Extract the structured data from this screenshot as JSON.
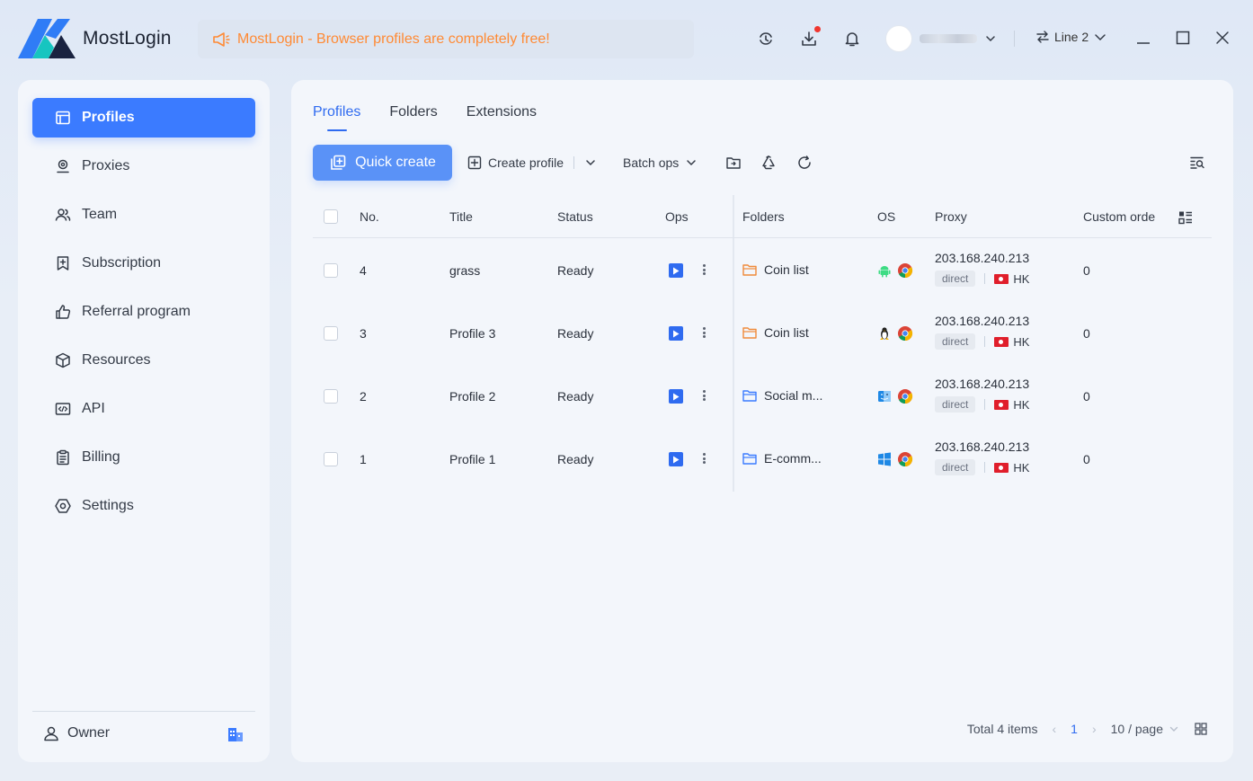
{
  "app": {
    "brand": "MostLogin",
    "announcement": "MostLogin - Browser profiles are completely free!",
    "line_label": "Line 2",
    "accent_color": "#3b7bff",
    "announce_color": "#ff8a34"
  },
  "sidebar": {
    "items": [
      {
        "label": "Profiles",
        "icon": "profile-window-icon",
        "active": true
      },
      {
        "label": "Proxies",
        "icon": "location-pin-icon"
      },
      {
        "label": "Team",
        "icon": "team-icon"
      },
      {
        "label": "Subscription",
        "icon": "bookmark-plus-icon"
      },
      {
        "label": "Referral program",
        "icon": "thumbs-up-icon"
      },
      {
        "label": "Resources",
        "icon": "cube-icon"
      },
      {
        "label": "API",
        "icon": "code-window-icon"
      },
      {
        "label": "Billing",
        "icon": "clipboard-icon"
      },
      {
        "label": "Settings",
        "icon": "gear-hexagon-icon"
      }
    ],
    "owner_label": "Owner"
  },
  "main": {
    "tabs": [
      {
        "label": "Profiles",
        "active": true
      },
      {
        "label": "Folders"
      },
      {
        "label": "Extensions"
      }
    ],
    "toolbar": {
      "quick_create": "Quick create",
      "create_profile": "Create profile",
      "batch_ops": "Batch ops"
    },
    "columns": {
      "no": "No.",
      "title": "Title",
      "status": "Status",
      "ops": "Ops",
      "folders": "Folders",
      "os": "OS",
      "proxy": "Proxy",
      "custom_order": "Custom orde"
    },
    "rows": [
      {
        "no": "4",
        "title": "grass",
        "status": "Ready",
        "folder": "Coin list",
        "folder_color": "#f08a3a",
        "os": "android-icon",
        "proxy_ip": "203.168.240.213",
        "proxy_type": "direct",
        "region": "HK",
        "order": "0"
      },
      {
        "no": "3",
        "title": "Profile 3",
        "status": "Ready",
        "folder": "Coin list",
        "folder_color": "#f08a3a",
        "os": "linux-icon",
        "proxy_ip": "203.168.240.213",
        "proxy_type": "direct",
        "region": "HK",
        "order": "0"
      },
      {
        "no": "2",
        "title": "Profile 2",
        "status": "Ready",
        "folder": "Social m...",
        "folder_color": "#3b7bff",
        "os": "macos-icon",
        "proxy_ip": "203.168.240.213",
        "proxy_type": "direct",
        "region": "HK",
        "order": "0"
      },
      {
        "no": "1",
        "title": "Profile 1",
        "status": "Ready",
        "folder": "E-comm...",
        "folder_color": "#3b7bff",
        "os": "windows-icon",
        "proxy_ip": "203.168.240.213",
        "proxy_type": "direct",
        "region": "HK",
        "order": "0"
      }
    ],
    "pagination": {
      "total": "Total 4 items",
      "current_page": "1",
      "page_size": "10 / page"
    }
  }
}
